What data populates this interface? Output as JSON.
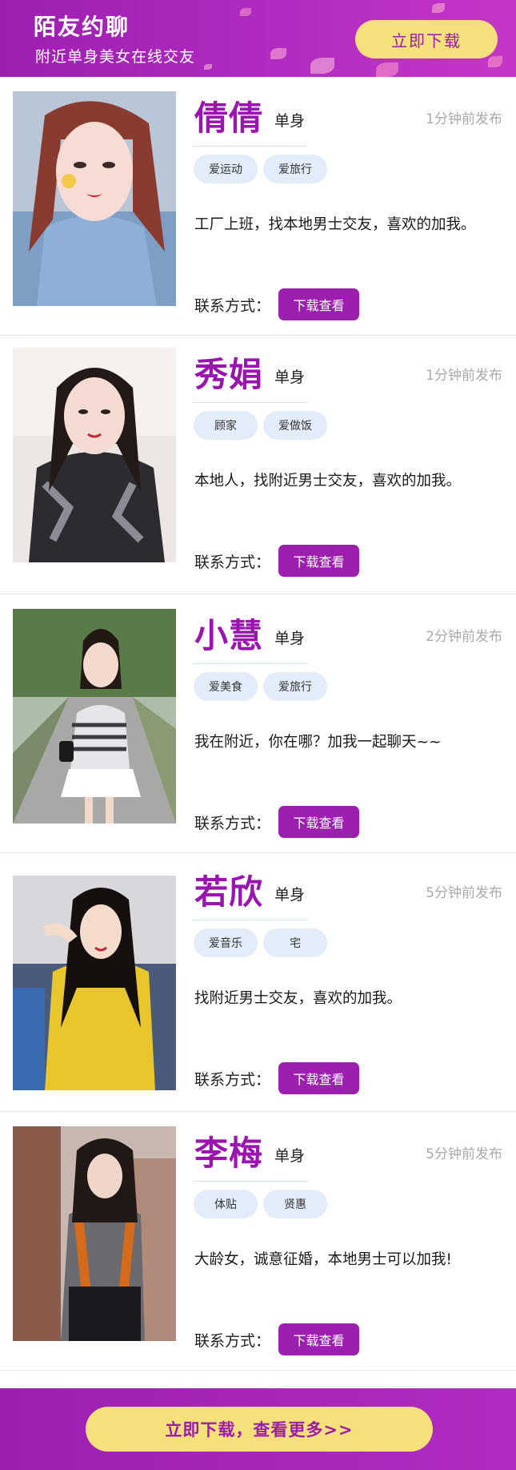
{
  "header": {
    "title": "陌友约聊",
    "subtitle": "附近单身美女在线交友",
    "download_label": "立即下载"
  },
  "profiles": [
    {
      "name": "倩倩",
      "status": "单身",
      "time": "1分钟前发布",
      "tags": [
        "爱运动",
        "爱旅行"
      ],
      "description": "工厂上班，找本地男士交友，喜欢的加我。",
      "contact_label": "联系方式：",
      "button_label": "下载查看"
    },
    {
      "name": "秀娟",
      "status": "单身",
      "time": "1分钟前发布",
      "tags": [
        "顾家",
        "爱做饭"
      ],
      "description": "本地人，找附近男士交友，喜欢的加我。",
      "contact_label": "联系方式：",
      "button_label": "下载查看"
    },
    {
      "name": "小慧",
      "status": "单身",
      "time": "2分钟前发布",
      "tags": [
        "爱美食",
        "爱旅行"
      ],
      "description": "我在附近，你在哪？加我一起聊天~~",
      "contact_label": "联系方式：",
      "button_label": "下载查看"
    },
    {
      "name": "若欣",
      "status": "单身",
      "time": "5分钟前发布",
      "tags": [
        "爱音乐",
        "宅"
      ],
      "description": "找附近男士交友，喜欢的加我。",
      "contact_label": "联系方式：",
      "button_label": "下载查看"
    },
    {
      "name": "李梅",
      "status": "单身",
      "time": "5分钟前发布",
      "tags": [
        "体贴",
        "贤惠"
      ],
      "description": "大龄女，诚意征婚，本地男士可以加我!",
      "contact_label": "联系方式：",
      "button_label": "下载查看"
    }
  ],
  "footer": {
    "download_label": "立即下载，查看更多>>"
  },
  "colors": {
    "brand_purple": "#9c1fb0",
    "button_yellow": "#f5e07b",
    "tag_blue": "#e3ecf9"
  }
}
